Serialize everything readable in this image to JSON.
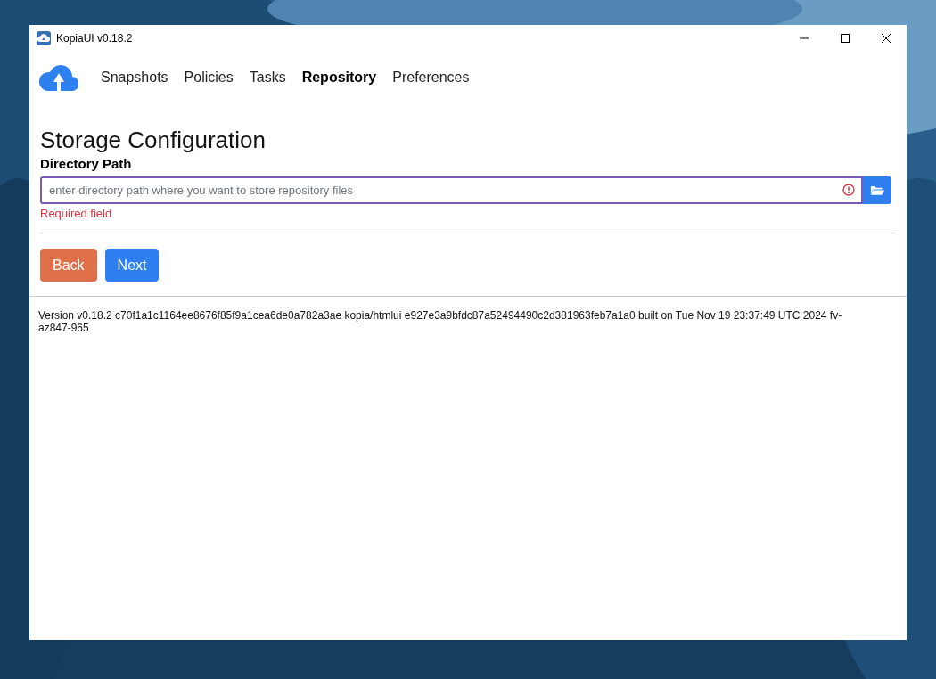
{
  "window": {
    "title": "KopiaUI v0.18.2"
  },
  "nav": [
    {
      "label": "Snapshots",
      "selected": false
    },
    {
      "label": "Policies",
      "selected": false
    },
    {
      "label": "Tasks",
      "selected": false
    },
    {
      "label": "Repository",
      "selected": true
    },
    {
      "label": "Preferences",
      "selected": false
    }
  ],
  "heading": "Storage Configuration",
  "field": {
    "label": "Directory Path",
    "placeholder": "enter directory path where you want to store repository files",
    "invalid": true,
    "error": "Required field"
  },
  "buttons": [
    {
      "label": "Back",
      "kind": "back"
    },
    {
      "label": "Next",
      "kind": "next"
    }
  ],
  "version": "Version v0.18.2 c70f1a1c1164ee8676f85f9a1cea6de0a782a3ae kopia/htmlui e927e3a9bfdc87a52494490c2d381963feb7a1a0 built on Tue Nov 19 23:37:49 UTC 2024 fv-az847-965"
}
